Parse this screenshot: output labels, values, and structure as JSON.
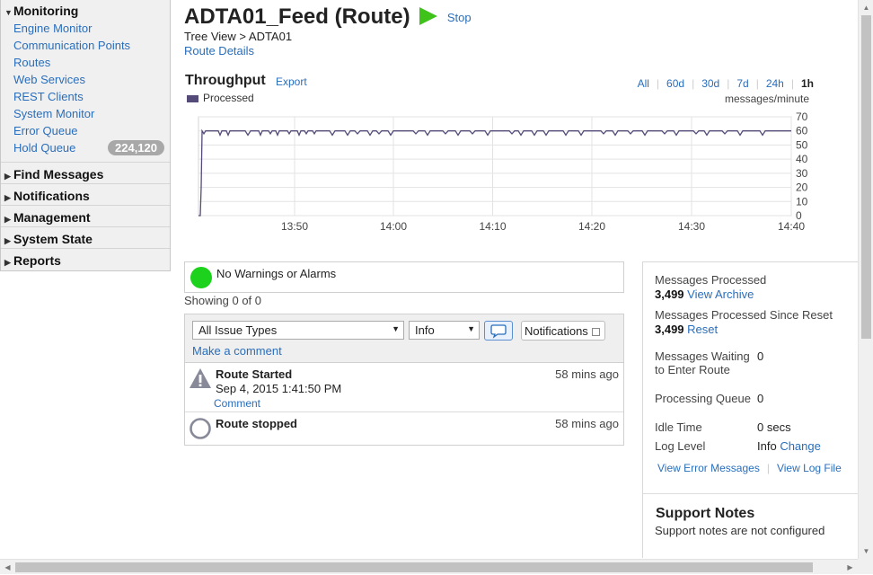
{
  "sidebar": {
    "monitoring": {
      "label": "Monitoring",
      "items": [
        {
          "label": "Engine Monitor"
        },
        {
          "label": "Communication Points"
        },
        {
          "label": "Routes"
        },
        {
          "label": "Web Services"
        },
        {
          "label": "REST Clients"
        },
        {
          "label": "System Monitor"
        },
        {
          "label": "Error Queue"
        },
        {
          "label": "Hold Queue",
          "badge": "224,120"
        }
      ]
    },
    "sections": [
      {
        "label": "Find Messages"
      },
      {
        "label": "Notifications"
      },
      {
        "label": "Management"
      },
      {
        "label": "System State"
      },
      {
        "label": "Reports"
      }
    ]
  },
  "header": {
    "title": "ADTA01_Feed (Route)",
    "stop_label": "Stop",
    "breadcrumb": "Tree View > ADTA01",
    "details_link": "Route Details",
    "play_color": "#3fc21a"
  },
  "throughput": {
    "title": "Throughput",
    "export_label": "Export",
    "legend_label": "Processed",
    "ranges": [
      "All",
      "60d",
      "30d",
      "7d",
      "24h",
      "1h"
    ],
    "active_range": "1h",
    "units_label": "messages/minute"
  },
  "chart_data": {
    "type": "line",
    "series": [
      {
        "name": "Processed",
        "color": "#554b78",
        "points": [
          [
            0,
            0
          ],
          [
            2,
            0
          ],
          [
            3,
            20
          ],
          [
            4,
            60
          ],
          [
            6,
            58
          ],
          [
            8,
            60
          ],
          [
            22,
            60
          ],
          [
            24,
            57
          ],
          [
            26,
            60
          ],
          [
            31,
            60
          ],
          [
            33,
            57
          ],
          [
            35,
            60
          ],
          [
            52,
            60
          ],
          [
            55,
            57
          ],
          [
            58,
            60
          ],
          [
            67,
            60
          ],
          [
            69,
            57
          ],
          [
            71,
            60
          ],
          [
            78,
            60
          ],
          [
            80,
            58
          ],
          [
            82,
            60
          ],
          [
            86,
            60
          ],
          [
            88,
            57
          ],
          [
            90,
            60
          ],
          [
            99,
            60
          ],
          [
            101,
            58
          ],
          [
            103,
            60
          ],
          [
            110,
            60
          ],
          [
            112,
            57
          ],
          [
            114,
            60
          ],
          [
            118,
            60
          ],
          [
            120,
            58
          ],
          [
            122,
            60
          ],
          [
            127,
            60
          ],
          [
            129,
            58
          ],
          [
            131,
            60
          ],
          [
            146,
            60
          ],
          [
            149,
            57
          ],
          [
            152,
            60
          ],
          [
            163,
            60
          ],
          [
            166,
            57
          ],
          [
            169,
            60
          ],
          [
            174,
            60
          ],
          [
            177,
            58
          ],
          [
            180,
            60
          ],
          [
            188,
            60
          ],
          [
            191,
            57
          ],
          [
            194,
            60
          ],
          [
            198,
            60
          ],
          [
            201,
            58
          ],
          [
            204,
            60
          ],
          [
            211,
            60
          ],
          [
            214,
            57
          ],
          [
            217,
            60
          ],
          [
            239,
            60
          ],
          [
            242,
            58
          ],
          [
            245,
            60
          ],
          [
            252,
            60
          ],
          [
            255,
            57
          ],
          [
            258,
            60
          ],
          [
            272,
            60
          ],
          [
            275,
            58
          ],
          [
            278,
            60
          ],
          [
            286,
            60
          ],
          [
            289,
            57
          ],
          [
            292,
            60
          ],
          [
            302,
            60
          ],
          [
            305,
            58
          ],
          [
            308,
            60
          ],
          [
            319,
            60
          ],
          [
            322,
            57
          ],
          [
            325,
            60
          ],
          [
            346,
            60
          ],
          [
            349,
            58
          ],
          [
            352,
            60
          ],
          [
            356,
            60
          ],
          [
            359,
            57
          ],
          [
            362,
            60
          ],
          [
            371,
            60
          ],
          [
            374,
            57
          ],
          [
            377,
            60
          ],
          [
            384,
            60
          ],
          [
            387,
            57
          ],
          [
            390,
            60
          ],
          [
            406,
            60
          ],
          [
            409,
            57
          ],
          [
            412,
            60
          ],
          [
            423,
            60
          ],
          [
            426,
            57
          ],
          [
            429,
            60
          ],
          [
            448,
            60
          ],
          [
            451,
            58
          ],
          [
            454,
            60
          ],
          [
            461,
            60
          ],
          [
            464,
            57
          ],
          [
            467,
            60
          ],
          [
            478,
            60
          ],
          [
            481,
            58
          ],
          [
            484,
            60
          ],
          [
            494,
            60
          ],
          [
            497,
            57
          ],
          [
            500,
            60
          ],
          [
            516,
            60
          ],
          [
            519,
            58
          ],
          [
            522,
            60
          ],
          [
            529,
            60
          ],
          [
            532,
            57
          ],
          [
            535,
            60
          ],
          [
            551,
            60
          ],
          [
            554,
            58
          ],
          [
            557,
            60
          ],
          [
            563,
            60
          ],
          [
            566,
            57
          ],
          [
            569,
            60
          ],
          [
            583,
            60
          ],
          [
            586,
            58
          ],
          [
            589,
            60
          ],
          [
            600,
            60
          ],
          [
            603,
            57
          ],
          [
            606,
            60
          ],
          [
            625,
            60
          ],
          [
            628,
            57
          ],
          [
            631,
            60
          ],
          [
            660,
            60
          ]
        ]
      }
    ],
    "x_ticks": [
      "13:50",
      "14:00",
      "14:10",
      "14:20",
      "14:30",
      "14:40"
    ],
    "x_tick_positions": [
      107,
      217,
      327.5,
      438,
      549,
      660
    ],
    "x_range": [
      0,
      660
    ],
    "y_ticks": [
      "0",
      "10",
      "20",
      "30",
      "40",
      "50",
      "60",
      "70"
    ],
    "ylim": [
      0,
      70
    ],
    "grid": true
  },
  "alarms": {
    "status_text": "No Warnings or Alarms",
    "status_color": "#1dd21d",
    "showing": "Showing 0 of 0"
  },
  "issues": {
    "type_filter": "All Issue Types",
    "level_filter": "Info",
    "notifications_label": "Notifications",
    "make_comment": "Make a comment",
    "events": [
      {
        "title": "Route Started",
        "date": "Sep 4, 2015 1:41:50 PM",
        "comment": "Comment",
        "time": "58 mins ago",
        "icon": "warning-icon"
      },
      {
        "title": "Route stopped",
        "time": "58 mins ago",
        "icon": "circle-icon"
      }
    ]
  },
  "stats": {
    "processed_label": "Messages Processed",
    "processed_value": "3,499",
    "view_archive": "View Archive",
    "since_reset_label": "Messages Processed Since Reset",
    "since_reset_value": "3,499",
    "reset_link": "Reset",
    "waiting_label": "Messages Waiting to Enter Route",
    "waiting_value": "0",
    "processing_label": "Processing Queue",
    "processing_value": "0",
    "idle_label": "Idle Time",
    "idle_value": "0 secs",
    "log_label": "Log Level",
    "log_value": "Info",
    "change_link": "Change",
    "view_errors": "View Error Messages",
    "view_log": "View Log File",
    "support_title": "Support Notes",
    "support_text": "Support notes are not configured"
  }
}
